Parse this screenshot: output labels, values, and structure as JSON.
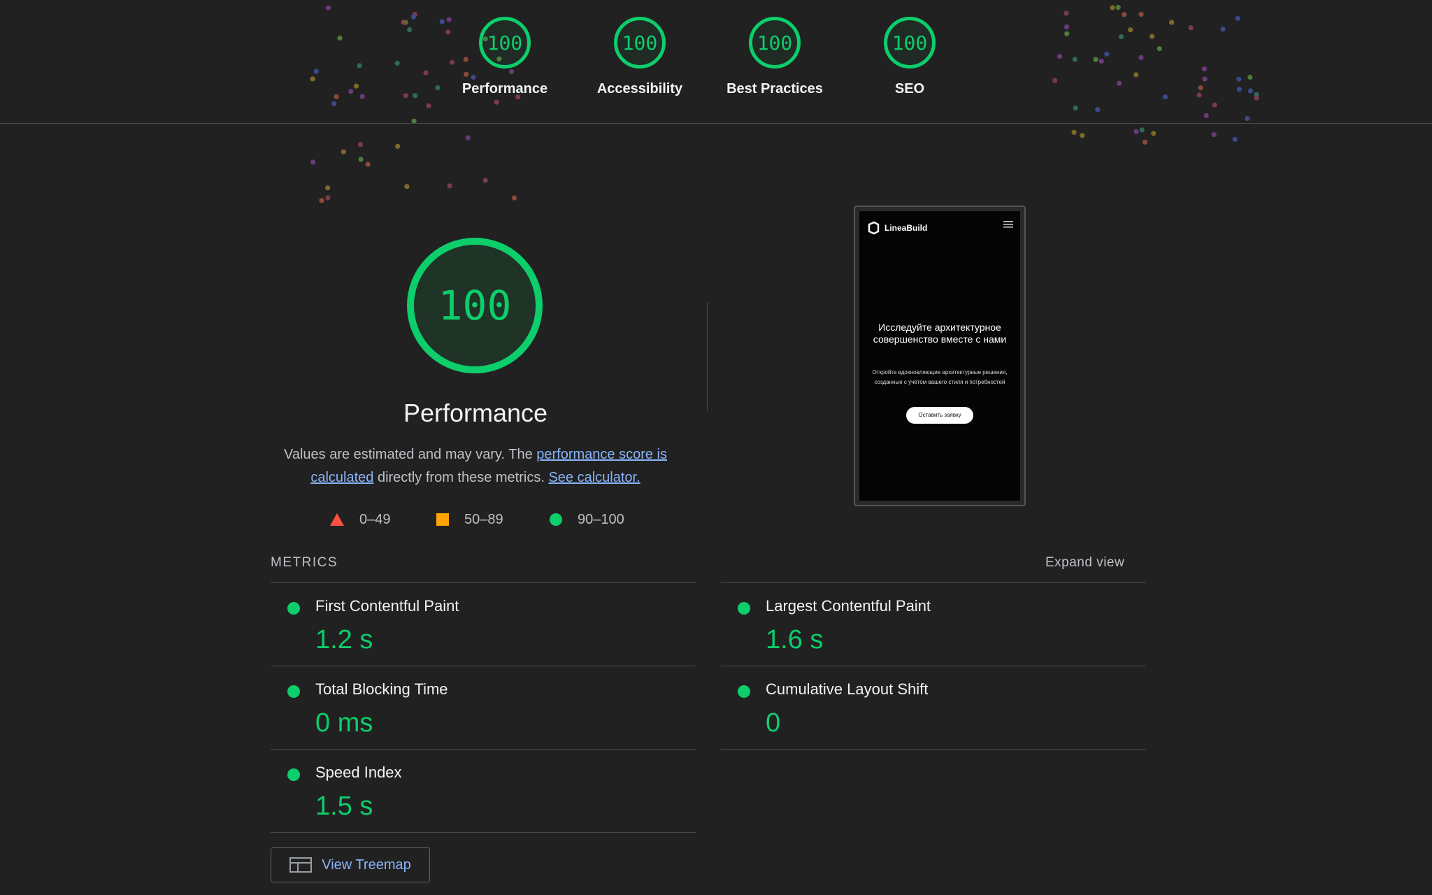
{
  "categories": [
    {
      "score": "100",
      "label": "Performance"
    },
    {
      "score": "100",
      "label": "Accessibility"
    },
    {
      "score": "100",
      "label": "Best Practices"
    },
    {
      "score": "100",
      "label": "SEO"
    }
  ],
  "performance": {
    "score": "100",
    "title": "Performance",
    "desc_prefix": "Values are estimated and may vary. The ",
    "desc_link1": "performance score is calculated",
    "desc_middle": " directly from these metrics. ",
    "desc_link2": "See calculator."
  },
  "legend": [
    {
      "shape": "triangle",
      "range": "0–49",
      "color": "#ff4e42"
    },
    {
      "shape": "square",
      "range": "50–89",
      "color": "#ffa400"
    },
    {
      "shape": "circle",
      "range": "90–100",
      "color": "#0cce6b"
    }
  ],
  "screenshot": {
    "brand": "LineaBuild",
    "menu_icon": "hamburger-icon",
    "headline": "Исследуйте архитектурное совершенство вместе с нами",
    "subtext": "Откройте вдохновляющие архитектурные решения, созданные с учётом вашего стиля и потребностей",
    "cta": "Оставить заявку"
  },
  "metrics": {
    "title": "METRICS",
    "expand_label": "Expand view",
    "items": [
      {
        "name": "First Contentful Paint",
        "value": "1.2 s"
      },
      {
        "name": "Largest Contentful Paint",
        "value": "1.6 s"
      },
      {
        "name": "Total Blocking Time",
        "value": "0 ms"
      },
      {
        "name": "Cumulative Layout Shift",
        "value": "0"
      },
      {
        "name": "Speed Index",
        "value": "1.5 s"
      }
    ]
  },
  "treemap": {
    "label": "View Treemap",
    "icon": "treemap-icon"
  },
  "colors": {
    "pass": "#0cce6b",
    "average": "#ffa400",
    "fail": "#ff4e42",
    "link": "#8ab4f8",
    "background": "#212121"
  }
}
